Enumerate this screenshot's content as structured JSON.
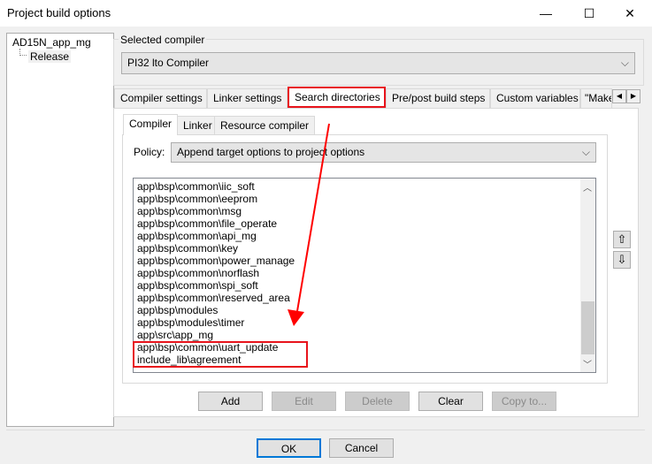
{
  "window": {
    "title": "Project build options",
    "minimize": "—",
    "maximize": "☐",
    "close": "✕"
  },
  "tree": {
    "root": "AD15N_app_mg",
    "child": "Release"
  },
  "compiler_group": {
    "label": "Selected compiler",
    "value": "PI32 lto Compiler"
  },
  "tabs": [
    {
      "label": "Compiler settings"
    },
    {
      "label": "Linker settings"
    },
    {
      "label": "Search directories",
      "active": true
    },
    {
      "label": "Pre/post build steps"
    },
    {
      "label": "Custom variables"
    },
    {
      "label": "\"Make\" commands"
    }
  ],
  "subtabs": [
    {
      "label": "Compiler",
      "active": true
    },
    {
      "label": "Linker"
    },
    {
      "label": "Resource compiler"
    }
  ],
  "policy": {
    "label": "Policy:",
    "value": "Append target options to project options"
  },
  "directories": [
    "app\\bsp\\common\\iic_soft",
    "app\\bsp\\common\\eeprom",
    "app\\bsp\\common\\msg",
    "app\\bsp\\common\\file_operate",
    "app\\bsp\\common\\api_mg",
    "app\\bsp\\common\\key",
    "app\\bsp\\common\\power_manage",
    "app\\bsp\\common\\norflash",
    "app\\bsp\\common\\spi_soft",
    "app\\bsp\\common\\reserved_area",
    "app\\bsp\\modules",
    "app\\bsp\\modules\\timer",
    "app\\src\\app_mg",
    "app\\bsp\\common\\uart_update",
    "include_lib\\agreement"
  ],
  "buttons": {
    "add": "Add",
    "edit": "Edit",
    "delete": "Delete",
    "clear": "Clear",
    "copy": "Copy to...",
    "ok": "OK",
    "cancel": "Cancel",
    "up": "⇧",
    "down": "⇩"
  },
  "annotation_color": "#ff0000"
}
